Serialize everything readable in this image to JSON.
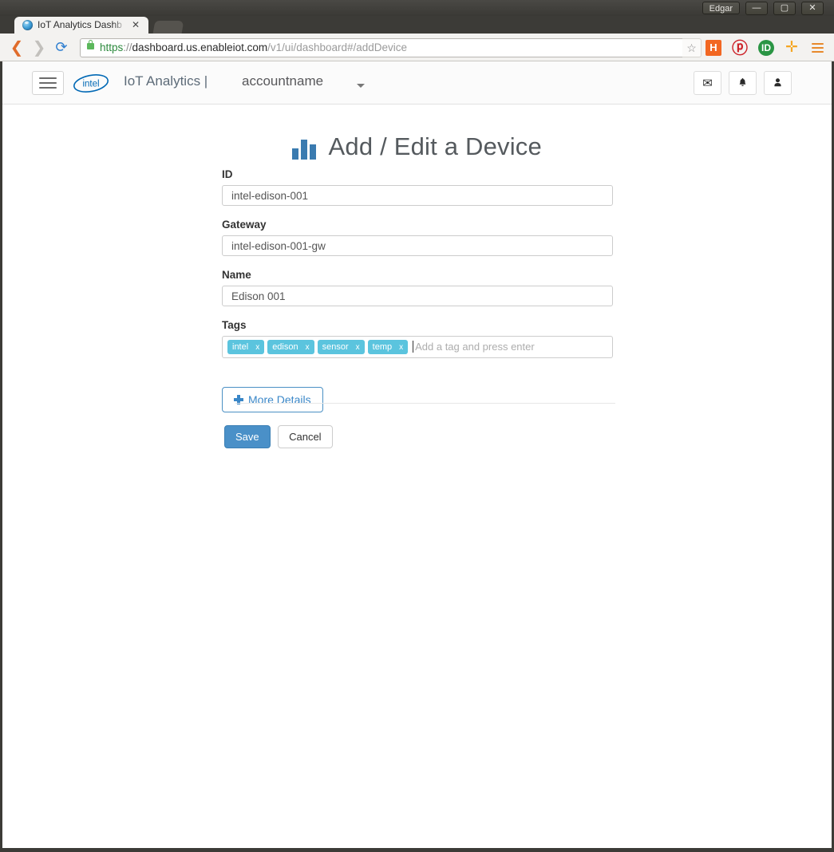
{
  "window": {
    "user_label": "Edgar",
    "minimize": "—",
    "maximize": "▢",
    "close": "✕"
  },
  "browser": {
    "tab": {
      "title": "IoT Analytics Dashb",
      "close": "✕"
    },
    "nav": {
      "back": "❮",
      "forward": "❯",
      "reload": "⟳"
    },
    "url": {
      "scheme": "https",
      "separator": "://",
      "host": "dashboard.us.enableiot.com",
      "path": "/v1/ui/dashboard#/addDevice",
      "full": "https://dashboard.us.enableiot.com/v1/ui/dashboard#/addDevice"
    },
    "bookmark_star": "☆",
    "extensions": [
      {
        "name": "hootsuite-extension",
        "label": "H",
        "color": "#f26722"
      },
      {
        "name": "pinterest-extension",
        "label": "ⓟ",
        "color": "#cc2127"
      },
      {
        "name": "lastpass-extension",
        "label": "ID",
        "color": "#2a9544"
      },
      {
        "name": "add-extension",
        "label": "✛",
        "color": "#f5a623"
      }
    ]
  },
  "appbar": {
    "brand": "IoT Analytics |",
    "account": "accountname",
    "logo_text": "intel",
    "mail_icon": "✉",
    "bell_icon": "🔔",
    "user_icon": "👤"
  },
  "page": {
    "title": "Add / Edit a Device"
  },
  "form": {
    "id": {
      "label": "ID",
      "value": "intel-edison-001",
      "placeholder": ""
    },
    "gateway": {
      "label": "Gateway",
      "value": "intel-edison-001-gw",
      "placeholder": ""
    },
    "name": {
      "label": "Name",
      "value": "Edison 001",
      "placeholder": ""
    },
    "tags": {
      "label": "Tags",
      "items": [
        "intel",
        "edison",
        "sensor",
        "temp"
      ],
      "remove_label": "x",
      "placeholder": "Add a tag and press enter"
    },
    "more_details_label": "More Details",
    "save_label": "Save",
    "cancel_label": "Cancel"
  },
  "colors": {
    "primary": "#4a90c8",
    "tag": "#5bc4de",
    "link": "#3a87c8",
    "chart_icon": "#3a7bb0"
  }
}
